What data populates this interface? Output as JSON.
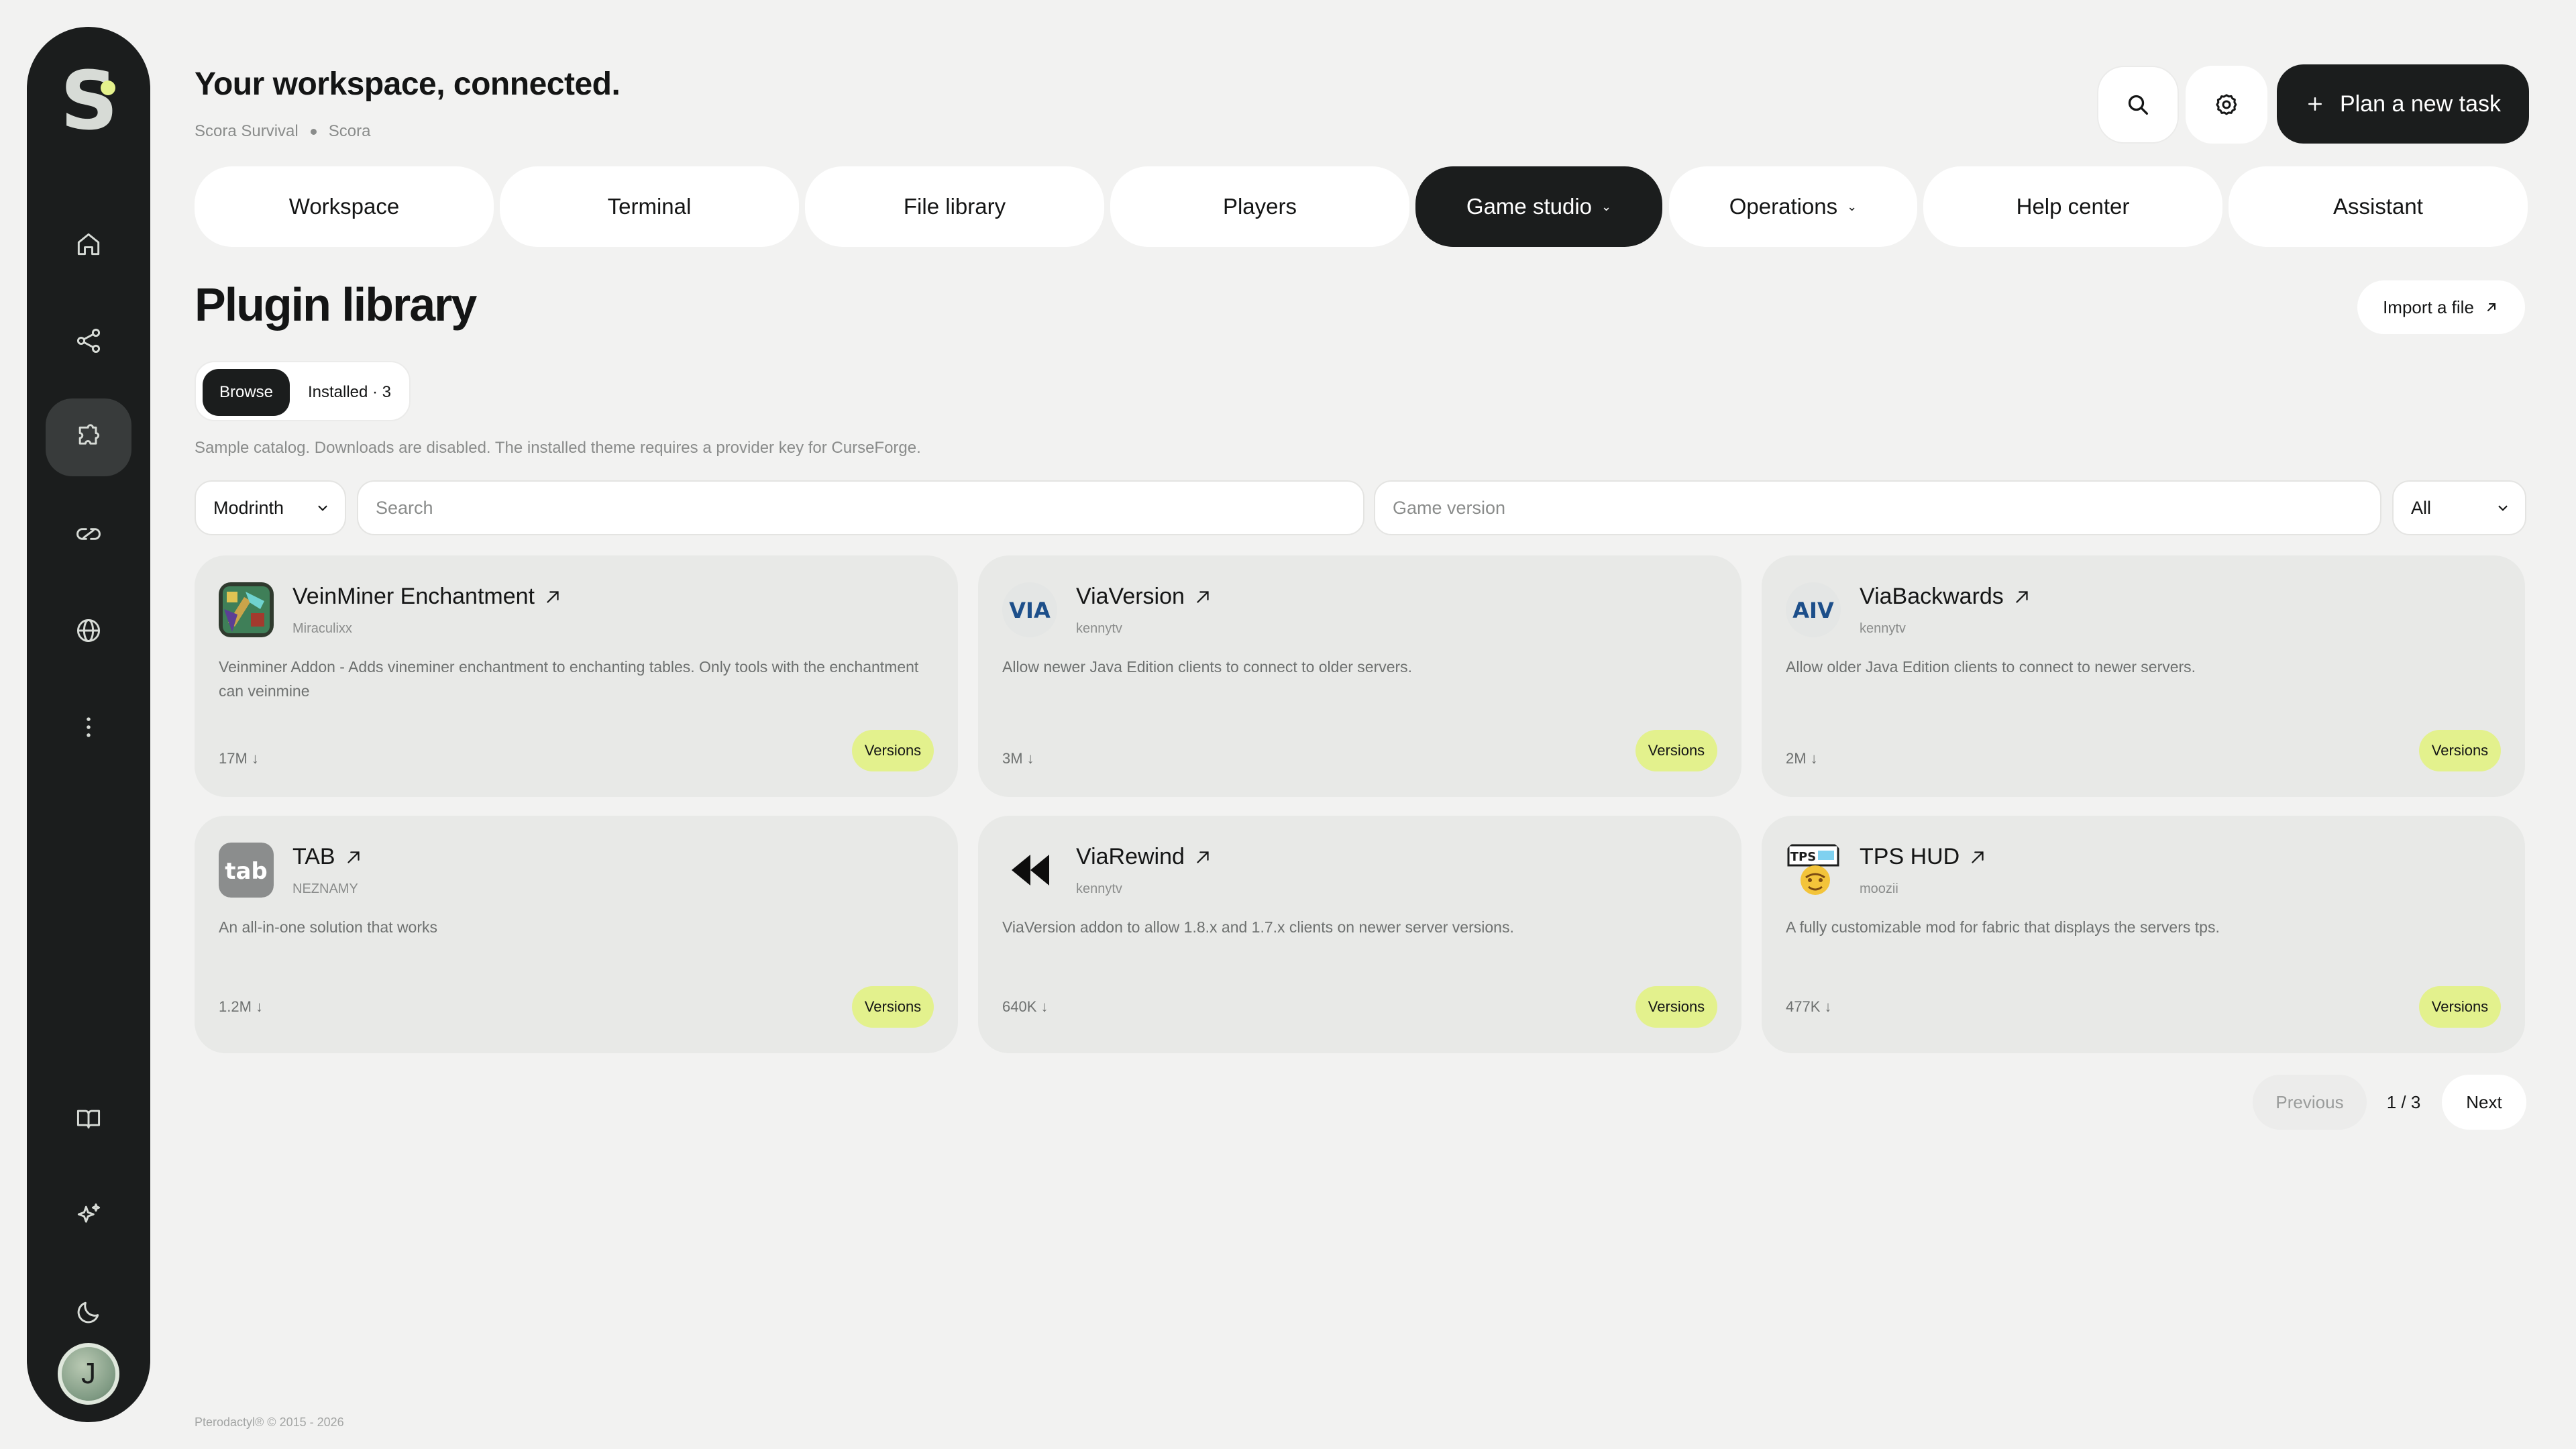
{
  "header": {
    "title": "Your workspace, connected.",
    "breadcrumb": [
      "Scora Survival",
      "Scora"
    ],
    "plan_button": "Plan a new task"
  },
  "sidebar": {
    "logo": "S",
    "items": [
      {
        "icon": "home-icon"
      },
      {
        "icon": "share-nodes-icon"
      },
      {
        "icon": "puzzle-icon",
        "active": true
      },
      {
        "icon": "link-icon"
      },
      {
        "icon": "globe-icon"
      },
      {
        "icon": "more-vertical-icon"
      },
      {
        "icon": "book-icon"
      },
      {
        "icon": "sparkles-icon"
      },
      {
        "icon": "moon-icon"
      }
    ],
    "avatar_initial": "J"
  },
  "tabs": [
    {
      "label": "Workspace"
    },
    {
      "label": "Terminal"
    },
    {
      "label": "File library"
    },
    {
      "label": "Players"
    },
    {
      "label": "Game studio",
      "active": true,
      "dropdown": true
    },
    {
      "label": "Operations",
      "dropdown": true
    },
    {
      "label": "Help center"
    },
    {
      "label": "Assistant"
    }
  ],
  "library": {
    "title": "Plugin library",
    "import_label": "Import a file",
    "segments": {
      "browse": "Browse",
      "installed": "Installed · 3"
    },
    "notice": "Sample catalog. Downloads are disabled. The installed theme requires a provider key for CurseForge.",
    "filters": {
      "source": "Modrinth",
      "search_placeholder": "Search",
      "version_placeholder": "Game version",
      "loader": "All"
    },
    "versions_label": "Versions",
    "plugins": [
      {
        "name": "VeinMiner Enchantment",
        "author": "Miraculixx",
        "description": "Veinminer Addon - Adds vineminer enchantment to enchanting tables. Only tools with the enchantment can veinmine",
        "downloads": "17M ↓"
      },
      {
        "name": "ViaVersion",
        "author": "kennytv",
        "description": "Allow newer Java Edition clients to connect to older servers.",
        "downloads": "3M ↓"
      },
      {
        "name": "ViaBackwards",
        "author": "kennytv",
        "description": "Allow older Java Edition clients to connect to newer servers.",
        "downloads": "2M ↓"
      },
      {
        "name": "TAB",
        "author": "NEZNAMY",
        "description": "An all-in-one solution that works",
        "downloads": "1.2M ↓"
      },
      {
        "name": "ViaRewind",
        "author": "kennytv",
        "description": "ViaVersion addon to allow 1.8.x and 1.7.x clients on newer server versions.",
        "downloads": "640K ↓"
      },
      {
        "name": "TPS HUD",
        "author": "moozii",
        "description": "A fully customizable mod for fabric that displays the servers tps.",
        "downloads": "477K ↓"
      }
    ],
    "pagination": {
      "previous": "Previous",
      "page": "1 / 3",
      "next": "Next"
    }
  },
  "icon_text": {
    "via": "VIA",
    "aiv": "AIV",
    "tab": "tab",
    "tps": "TPS"
  },
  "footer": "Pterodactyl® © 2015 - 2026",
  "colors": {
    "background": "#f2f2f1",
    "sidebar": "#1b1d1d",
    "accent": "#e3f18d",
    "card": "#e8e9e7"
  }
}
